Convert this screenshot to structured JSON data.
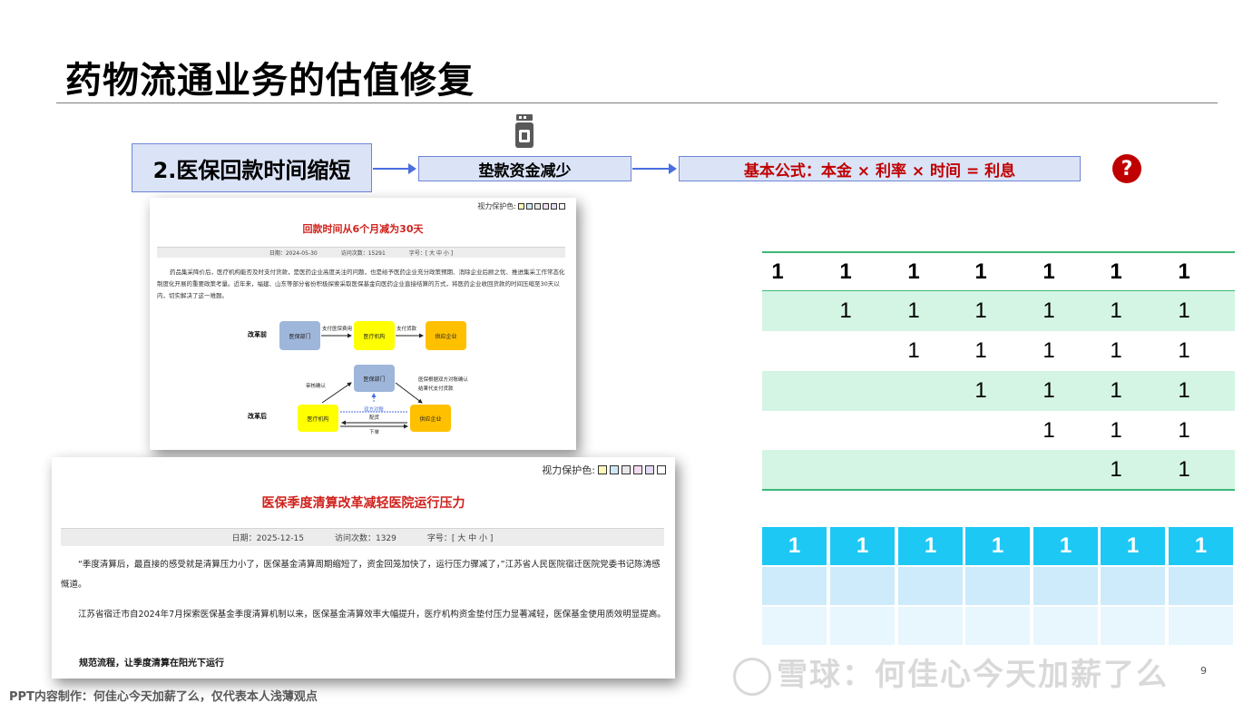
{
  "slide": {
    "title": "药物流通业务的估值修复",
    "page_number": "9",
    "footer": "PPT内容制作：何佳心今天加薪了么，仅代表本人浅薄观点",
    "watermark": "雪球：何佳心今天加薪了么"
  },
  "flow": {
    "box1": "2.医保回款时间缩短",
    "box2": "垫款资金减少",
    "box3": "基本公式：本金 × 利率 × 时间 = 利息",
    "question_mark": "?",
    "accent_color": "#c00000"
  },
  "article1": {
    "eye_label": "视力保护色:",
    "title": "回款时间从6个月减为30天",
    "date": "日期：2024-05-30",
    "visits": "访问次数：15291",
    "font_size": "字号：[ 大 中 小 ]",
    "body": "药品集采降价后，医疗机构能否及时支付货款，是医药企业高度关注的问题，也是给予医药企业充分政策预期、消除企业后顾之忧、推进集采工作常态化制度化开展的重要政策考量。近年来，福建、山东等部分省份积极探索采取医保基金向医药企业直接结算的方式，将医药企业收回货款的时间压缩至30天以内，切实解决了这一难题。",
    "diagram": {
      "before_label": "改革前",
      "after_label": "改革后",
      "node_insurance": "医保部门",
      "node_hospital": "医疗机构",
      "node_supplier": "供应企业",
      "edge_pay_insurance": "支付医保费用",
      "edge_pay_goods": "支付货款",
      "edge_review": "审核确认",
      "edge_direct": "医保根据双方对账确认\n结果代支付货款",
      "edge_reconcile": "双方对账",
      "edge_deliver": "配货",
      "edge_order": "下单"
    }
  },
  "article2": {
    "eye_label": "视力保护色:",
    "title": "医保季度清算改革减轻医院运行压力",
    "date": "日期：2025-12-15",
    "visits": "访问次数：1329",
    "font_size": "字号：[ 大 中 小 ]",
    "para1": "“季度清算后，最直接的感受就是清算压力小了，医保基金清算周期缩短了，资金回笼加快了，运行压力骤减了，”江苏省人民医院宿迁医院党委书记陈涛感慨道。",
    "para2": "江苏省宿迁市自2024年7月探索医保基金季度清算机制以来，医保基金清算效率大幅提升，医疗机构资金垫付压力显著减轻，医保基金使用质效明显提高。",
    "subheading": "规范流程，让季度清算在阳光下运行"
  },
  "table1": {
    "header": [
      "1",
      "1",
      "1",
      "1",
      "1",
      "1",
      "1"
    ],
    "rows": [
      [
        "",
        "1",
        "1",
        "1",
        "1",
        "1",
        "1"
      ],
      [
        "",
        "",
        "1",
        "1",
        "1",
        "1",
        "1"
      ],
      [
        "",
        "",
        "",
        "1",
        "1",
        "1",
        "1"
      ],
      [
        "",
        "",
        "",
        "",
        "1",
        "1",
        "1"
      ],
      [
        "",
        "",
        "",
        "",
        "",
        "1",
        "1"
      ]
    ]
  },
  "table2": {
    "header": [
      "1",
      "1",
      "1",
      "1",
      "1",
      "1",
      "1"
    ],
    "rows": [
      [
        "",
        "",
        "",
        "",
        "",
        "",
        ""
      ],
      [
        "",
        "",
        "",
        "",
        "",
        "",
        ""
      ]
    ]
  }
}
